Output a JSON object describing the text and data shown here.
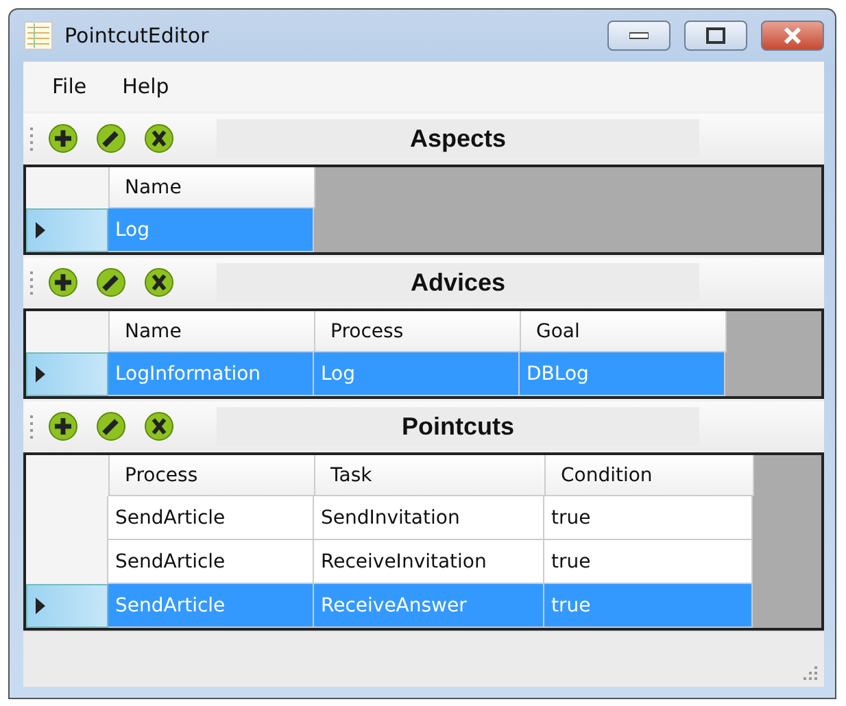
{
  "window": {
    "title": "PointcutEditor"
  },
  "menu": [
    {
      "label": "File"
    },
    {
      "label": "Help"
    }
  ],
  "sections": [
    {
      "title": "Aspects",
      "columns": [
        "Name"
      ],
      "rows": [
        {
          "selected": true,
          "cells": [
            "Log"
          ]
        }
      ]
    },
    {
      "title": "Advices",
      "columns": [
        "Name",
        "Process",
        "Goal"
      ],
      "rows": [
        {
          "selected": true,
          "cells": [
            "LogInformation",
            "Log",
            "DBLog"
          ]
        }
      ]
    },
    {
      "title": "Pointcuts",
      "columns": [
        "Process",
        "Task",
        "Condition"
      ],
      "rows": [
        {
          "selected": false,
          "cells": [
            "SendArticle",
            "SendInvitation",
            "true"
          ]
        },
        {
          "selected": false,
          "cells": [
            "SendArticle",
            "ReceiveInvitation",
            "true"
          ]
        },
        {
          "selected": true,
          "cells": [
            "SendArticle",
            "ReceiveAnswer",
            "true"
          ]
        }
      ]
    }
  ]
}
